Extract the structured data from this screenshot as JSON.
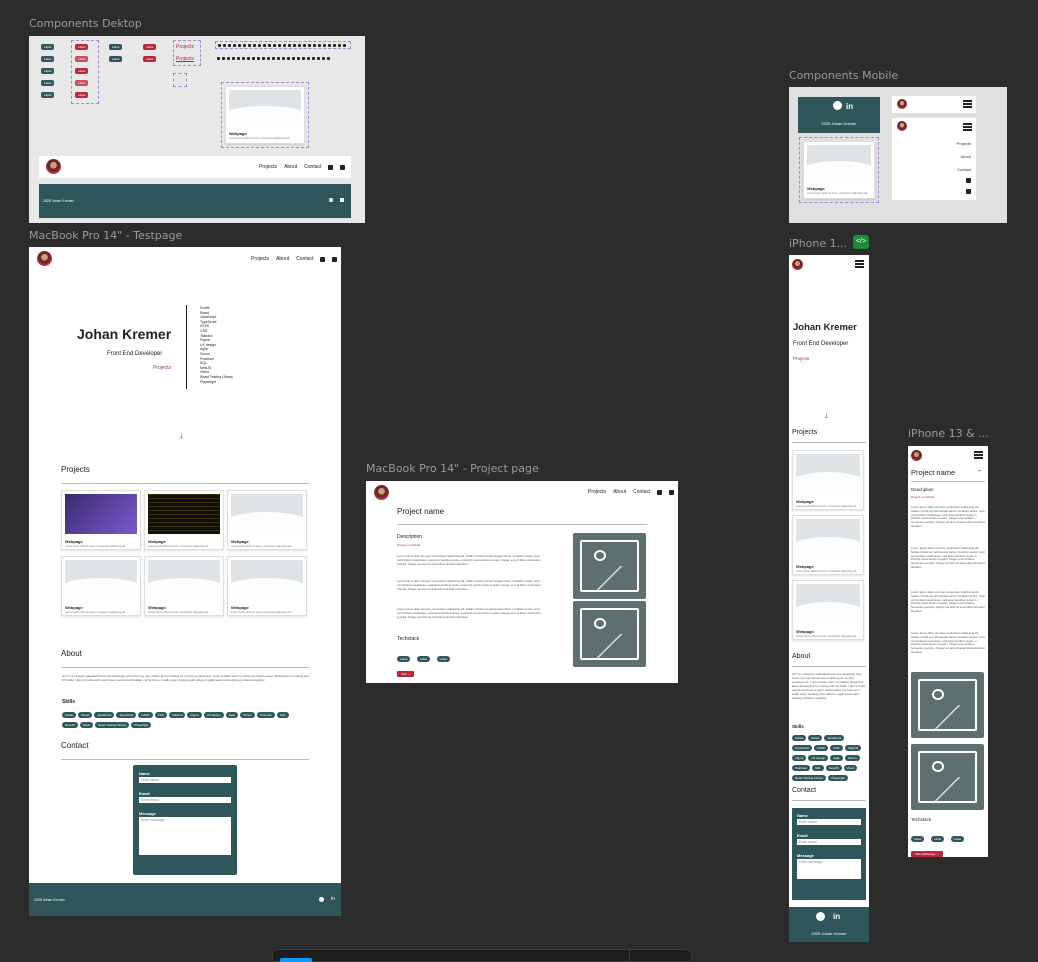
{
  "frames": {
    "components_desktop": {
      "label": "Components Dektop"
    },
    "components_mobile": {
      "label": "Components Mobile"
    },
    "testpage": {
      "label": "MacBook Pro 14\" - Testpage"
    },
    "projectpage": {
      "label": "MacBook Pro 14\" - Project page"
    },
    "iphone1": {
      "label": "iPhone 1..."
    },
    "iphone13": {
      "label": "iPhone 13 & ..."
    }
  },
  "components": {
    "label": "Label",
    "projects": "Projects",
    "webpage": "Webpage",
    "webpage_desc": "Lorem ipsum dolor sit amet, consectetur adipiscing elit.",
    "year": "2025 Johan Kremer",
    "nav": [
      "Projects",
      "About",
      "Contact"
    ]
  },
  "testpage": {
    "name": "Johan Kremer",
    "role": "Front End Developer",
    "projects_link": "Projects",
    "skills_list": [
      "Svelte",
      "React",
      "JavaScript",
      "TypeScript",
      "HTML",
      "CSS",
      "Tailwind",
      "Figma",
      "UX design",
      "Agile",
      "Scrum",
      "Postman",
      "SQL",
      "NestJS",
      "Vitest",
      "React Testing Library",
      "Playwright"
    ],
    "projects_title": "Projects",
    "card_title": "Webpage",
    "card_desc": "Lorem ipsum dolor sit amet, consectetur adipiscing elit.",
    "about_title": "About",
    "about_text": "Hi! I'm a recently graduated front end developer who loves my new career and is looking for my first employment. I love to learn and I'm looking forward to keep developing my coding and UX skills. I like to build and fix and love to learn and broaden my horizons. I really enjoy working with others in agile teams and solving problems together.",
    "skills_title": "Skills",
    "contact_title": "Contact",
    "form": {
      "name": "Name",
      "name_ph": "Enter name",
      "email": "Email",
      "email_ph": "Enter email",
      "message": "Message",
      "message_ph": "Enter message"
    },
    "footer": "2025 Johan Kremer"
  },
  "projectpage": {
    "title": "Project name",
    "desc_title": "Description",
    "github": "Project on Github",
    "lorem": "Lorem ipsum dolor sit amet, consectetur adipiscing elit. Nullam id felis vel velit feugiat varius. Curabitur auctor, nunc vel tincidunt scelerisque, velit justo faucibus metus, a lobortis metus lectus et quam. Integer eros id libero fermentum suscipit. Integer vel ante sit amet libero tincidunt faucibus.",
    "techstack": "Techstack",
    "tags": [
      "Label",
      "Label",
      "Label"
    ],
    "visit": "Visit →"
  },
  "iphone": {
    "name": "Johan Kremer",
    "role": "Front End Developer",
    "projects_link": "Projects",
    "projects_title": "Projects",
    "about_title": "About",
    "about_text": "Hi! I'm a recently graduated front end developer who loves my new career and is looking for my first employment. I love to learn and I'm looking forward to keep developing my coding and UX skills. I like to build and fix and love to learn and broaden my horizons. I really enjoy working with others in agile teams and solving problems together.",
    "skills_title": "Skills",
    "contact_title": "Contact",
    "footer": "2025 Johan Kremer"
  },
  "iphone13": {
    "title": "Project name",
    "desc_title": "Description",
    "github": "Project on Github",
    "techstack": "Techstack",
    "tags": [
      "Label",
      "Label",
      "Label"
    ],
    "visit": "Visit webbpage →"
  },
  "colors": {
    "teal": "#2f565b",
    "accent": "#b8283c",
    "canvas": "#2c2c2c"
  }
}
